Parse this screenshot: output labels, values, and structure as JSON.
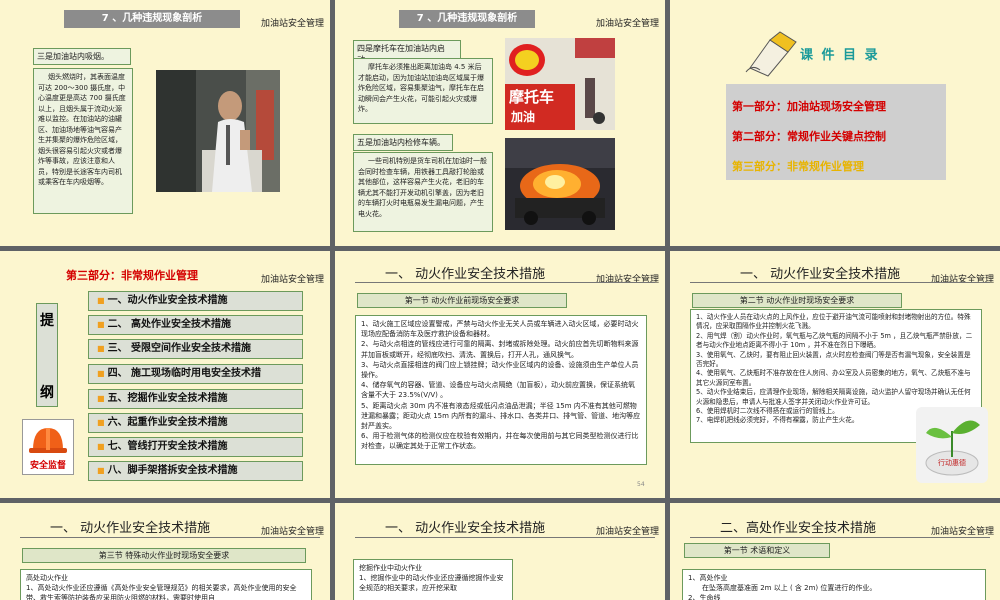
{
  "slide1": {
    "title": "7 、几种违规现象剖析",
    "header": "加油站安全管理",
    "label": "三是加油站内吸烟。",
    "body": "烟头燃烧时，其表面温度可达 200～300 摄氏度，中心温度更是高达 700 摄氏度以上，且烟头属于流动火源难以监控。在加油站的油罐区、加油场地等油气容易产生并集聚的爆炸危险区域，烟头很容易引起火灾或者爆炸等事故，应该注意和人员，特别是长途客车内司机或乘客在车内吸烟等。"
  },
  "slide2": {
    "title": "7 、几种违规现象剖析",
    "header": "加油站安全管理",
    "label1": "四是摩托车在加油站内启动。",
    "body1": "摩托车必须推出距离加油岛 4.5 米后才能启动，因为加油站加油岛区域属于爆炸危险区域，容易集聚油气，摩托车在启动瞬间会产生火花，可能引起火灾或爆炸。",
    "label2": "五是加油站内检修车辆。",
    "body2": "一些司机特别是货车司机在加油时一般会同时检查车辆，用铁器工具敲打轮胎或其他部位，这样容易产生火花，老旧的车辆尤其不能打开发动机引擎盖，因为老旧的车辆打火时电瓶易发生漏电问题，产生电火花。",
    "photo_text1": "摩托车",
    "photo_text2": "加油"
  },
  "slide3": {
    "title": "课 件 目 录",
    "items": [
      {
        "text": "第一部分：加油站现场安全管理",
        "color": "#d40000"
      },
      {
        "text": "第二部分：常规作业关键点控制",
        "color": "#d40000"
      },
      {
        "text": "第三部分：非常规作业管理",
        "color": "#e8b400"
      }
    ]
  },
  "slide4": {
    "title": "第三部分：非常规作业管理",
    "header": "加油站安全管理",
    "side_chars": [
      "提",
      "纲"
    ],
    "badge_text": "安全监督",
    "items": [
      "一、动火作业安全技术措施",
      "二、 高处作业安全技术措施",
      "三、 受限空间作业安全技术措施",
      "四、 施工现场临时用电安全技术措",
      "五、挖掘作业安全技术措施",
      "六、起重作业安全技术措施",
      "七、管线打开安全技术措施",
      "八、脚手架搭拆安全技术措施"
    ]
  },
  "slide5": {
    "title": "一、 动火作业安全技术措施",
    "header": "加油站安全管理",
    "bar": "第一节 动火作业前现场安全要求",
    "content": "1、动火施工区域应设置警戒，严禁与动火作业无关人员或车辆进入动火区域，必要时动火现场应配备消防车及医疗救护设备和器材。\n2、与动火点相连的管线应进行可靠的隔离、封堵或拆除处理。动火前应首先切断物料来源并加盲板或断开，经彻底吹扫、清洗、置换后，打开人孔，通风换气。\n3、与动火点直接相连的阀门应上锁挂牌；动火作业区域内的设备、设施须由生产单位人员操作。\n4、储存氧气的容器、管道、设备应与动火点隔绝（加盲板），动火前应置换，保证系统氧含量不大于 23.5%(V/V) 。\n5、距离动火点 30m 内不准有液态烃或低闪点油品泄漏；半径 15m 内不准有其他可燃物泄漏和暴露；距动火点 15m 内所有的漏斗、排水口、各类井口、排气管、管道、地沟等应封严盖实。\n6、用于检测气体的检测仪应在校验有效期内，并在每次使用前与其它同类型检测仪进行比对检查，以确定其处于正常工作状态。",
    "page_num": "54"
  },
  "slide6": {
    "title": "一、 动火作业安全技术措施",
    "header": "加油站安全管理",
    "bar": "第二节 动火作业时现场安全要求",
    "content": "1、动火作业人员在动火点的上风作业，应位于避开油气流可能喷射和封堵物射出的方位。特殊情况，应采取围隔作业并控制火花飞溅。\n2、用气焊（割）动火作业时，氧气瓶与乙炔气瓶的间隔不小于 5m ，且乙炔气瓶严禁卧放，二者与动火作业地点距离不得小于 10m ，并不准在烈日下曝晒。\n3、使用氧气、乙炔时，要有阻止回火装置，点火时应检查阀门等是否有漏气现象，安全装置是否完好。\n4、使用氧气、乙炔瓶时不准存放在住人房间、办公室及人员密集的地方，氧气、乙炔瓶不准与其它火源同室布置。\n5、动火作业结束后，应清理作业现场，解除相关隔离设施，动火监护人留守现场并确认无任何火源和隐患后，申请人与批准人签字并关闭动火作业许可证。\n6、使用焊机时二次线不得搭在或运行的管线上。\n7、电焊机把线必须完好，不得有裸露，防止产生火花。",
    "badge_text": "行动惠德"
  },
  "slide7": {
    "title": "一、 动火作业安全技术措施",
    "header": "加油站安全管理",
    "bar": "第三节 特殊动火作业时现场安全要求",
    "content": "高处动火作业\n1、高处动火作业还应遵循《高处作业安全管理规范》的相关要求，高处作业使用的安全带、救生索等防护装备应采用防火阻燃的材料，需要时使用自"
  },
  "slide8": {
    "title": "一、 动火作业安全技术措施",
    "header": "加油站安全管理",
    "content": "挖掘作业中动火作业\n1、挖掘作业中的动火作业还应遵循挖掘作业安全规范的相关要求，应开挖采取"
  },
  "slide9": {
    "title": "二、高处作业安全技术措施",
    "header": "加油站安全管理",
    "bar": "第一节 术语和定义",
    "content": "1、高处作业\n　　在坠落高度基准面 2m 以上 ( 含 2m) 位置进行的作业。\n2、生命线"
  }
}
